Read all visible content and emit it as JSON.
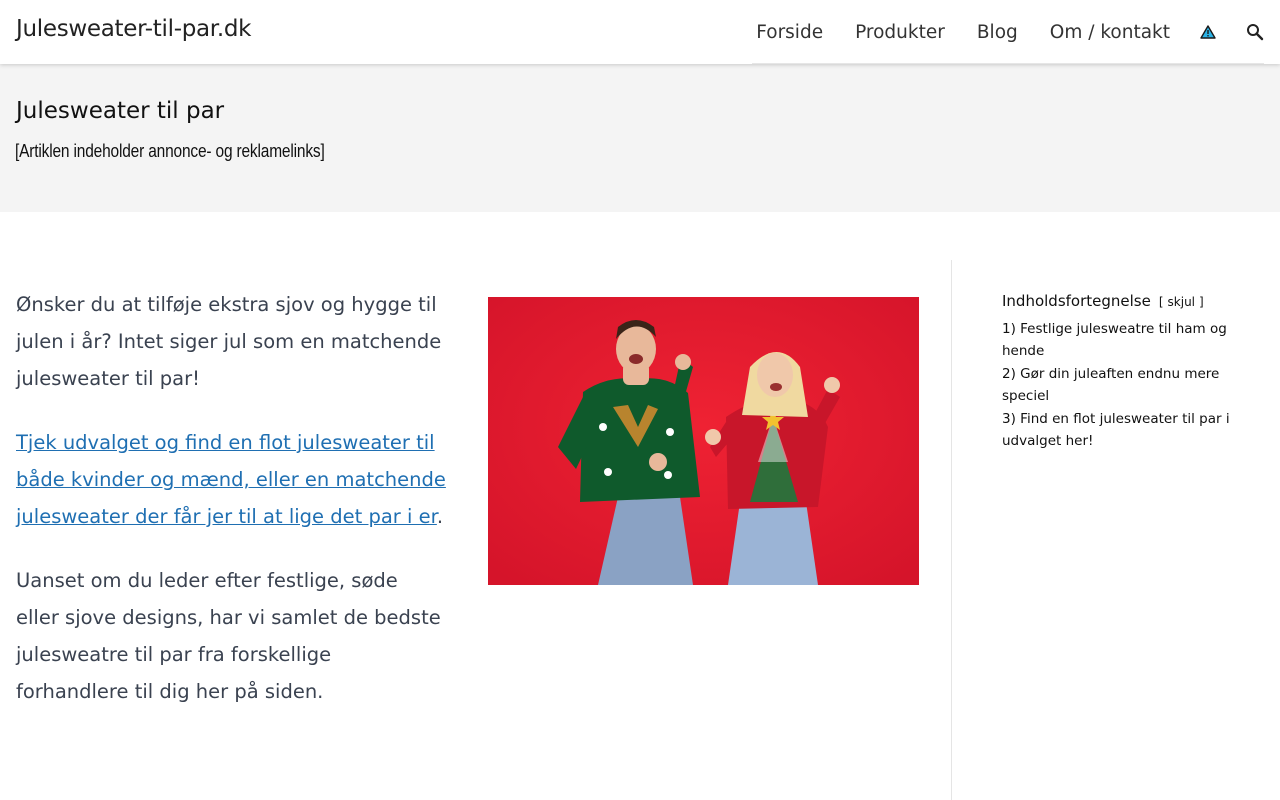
{
  "header": {
    "site_title": "Julesweater-til-par.dk",
    "nav": [
      {
        "label": "Forside"
      },
      {
        "label": "Produkter"
      },
      {
        "label": "Blog"
      },
      {
        "label": "Om / kontakt"
      }
    ],
    "icons": [
      "warning-triangle-icon",
      "search-icon"
    ]
  },
  "page": {
    "title": "Julesweater til par",
    "disclaimer": "[Artiklen indeholder annonce- og reklamelinks]"
  },
  "content": {
    "paragraph_1": "Ønsker du at tilføje ekstra sjov og hygge til julen i år? Intet siger jul som en matchende julesweater til par!",
    "link_text": "Tjek udvalget og find en flot julesweater til både kvinder og mænd, eller en matchende julesweater der får jer til at lige det par i er",
    "link_suffix": ".",
    "paragraph_3": "Uanset om du leder efter festlige, søde eller sjove designs, har vi samlet de bedste julesweatre til par fra forskellige forhandlere til dig her på siden."
  },
  "toc": {
    "title": "Indholdsfortegnelse",
    "toggle_open": "[",
    "toggle_label": "skjul",
    "toggle_close": "]",
    "items": [
      {
        "number": "1)",
        "label": "Festlige julesweatre til ham og hende"
      },
      {
        "number": "2)",
        "label": "Gør din juleaften endnu mere speciel"
      },
      {
        "number": "3)",
        "label": "Find en flot julesweater til par i udvalget her!"
      }
    ]
  },
  "colors": {
    "link": "#1f6fb2",
    "image_background": "#e01c2d",
    "title_band": "#f4f4f4"
  }
}
